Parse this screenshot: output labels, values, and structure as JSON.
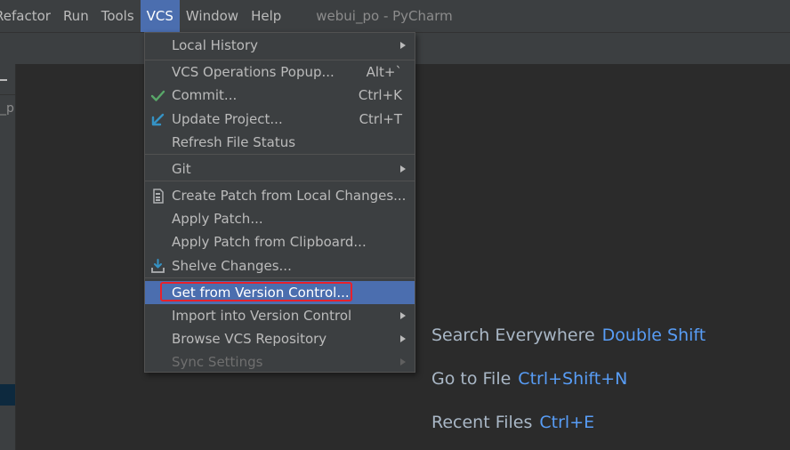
{
  "menubar": {
    "items": [
      "Refactor",
      "Run",
      "Tools",
      "VCS",
      "Window",
      "Help"
    ],
    "window_title": "webui_po - PyCharm"
  },
  "left_panel": {
    "fragment": "_p"
  },
  "vcs_menu": {
    "local_history": "Local History",
    "vcs_ops": {
      "label": "VCS Operations Popup...",
      "shortcut": "Alt+`"
    },
    "commit": {
      "label": "Commit...",
      "shortcut": "Ctrl+K"
    },
    "update": {
      "label": "Update Project...",
      "shortcut": "Ctrl+T"
    },
    "refresh": "Refresh File Status",
    "git": "Git",
    "create_patch": "Create Patch from Local Changes...",
    "apply_patch": "Apply Patch...",
    "apply_clipboard": "Apply Patch from Clipboard...",
    "shelve": "Shelve Changes...",
    "get_vc": "Get from Version Control...",
    "import_vc": "Import into Version Control",
    "browse": "Browse VCS Repository",
    "sync": "Sync Settings"
  },
  "welcome": {
    "search": {
      "label": "Search Everywhere",
      "key": "Double Shift"
    },
    "goto": {
      "label": "Go to File",
      "key": "Ctrl+Shift+N"
    },
    "recent": {
      "label": "Recent Files",
      "key": "Ctrl+E"
    }
  },
  "colors": {
    "menu_bg": "#3c3f41",
    "editor_bg": "#2b2b2b",
    "selection": "#4b6eaf",
    "highlight_box": "#e8212b",
    "shortcut_key": "#589df6",
    "check": "#59a869"
  },
  "icons": {
    "commit": "checkmark-icon",
    "update": "update-arrow-icon",
    "create_patch": "patch-file-icon",
    "shelve": "shelve-icon"
  }
}
